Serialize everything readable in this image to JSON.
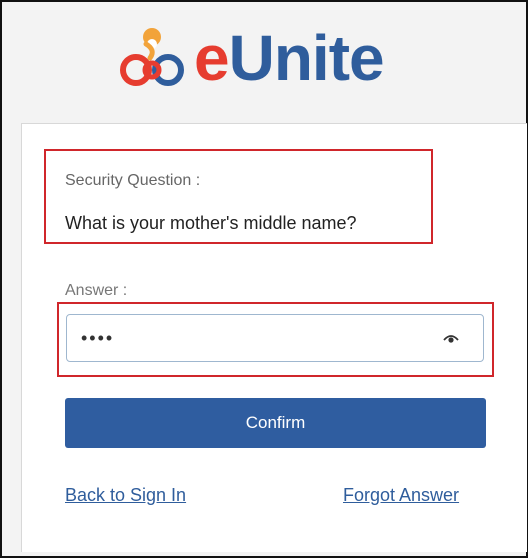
{
  "brand": {
    "logo_prefix": "e",
    "logo_suffix": "Unite",
    "colors": {
      "red": "#e63c2f",
      "blue": "#2f5d9c",
      "orange": "#f2a33a"
    },
    "icon": "interlinked-circles-logo-icon"
  },
  "security": {
    "question_label": "Security Question :",
    "question_text": "What is your mother's middle name?"
  },
  "answer": {
    "label": "Answer :",
    "value": "••••",
    "input_type": "password",
    "toggle_icon": "eye-icon"
  },
  "actions": {
    "confirm_label": "Confirm",
    "confirm_color": "#2f5da0",
    "back_link": "Back to Sign In",
    "forgot_link": "Forgot Answer"
  },
  "annotations": {
    "highlight_color": "#d0262b"
  }
}
